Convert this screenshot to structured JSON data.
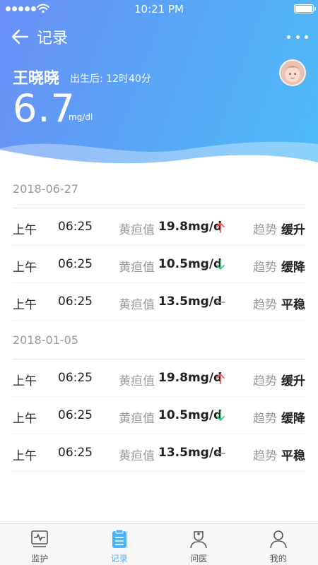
{
  "status_bar": {
    "time": "10:21 PM",
    "signal_bars": 5,
    "battery_level": 1.0
  },
  "nav": {
    "title": "记录",
    "back_icon": "back-arrow-icon",
    "more_icon": "more-dots-icon"
  },
  "baby": {
    "name": "王晓晓",
    "age_prefix": "出生后:",
    "age_value": "12时40分",
    "avatar_icon": "baby-avatar"
  },
  "current": {
    "value": "6.7",
    "unit": "mg/dl"
  },
  "groups": [
    {
      "date": "2018-06-27",
      "records": [
        {
          "period": "上午",
          "time": "06:25",
          "label": "黄疸值",
          "value": "19.8mg/d",
          "direction": "up",
          "trend_label": "趋势",
          "trend": "缓升"
        },
        {
          "period": "上午",
          "time": "06:25",
          "label": "黄疸值",
          "value": "10.5mg/d",
          "direction": "down",
          "trend_label": "趋势",
          "trend": "缓降"
        },
        {
          "period": "上午",
          "time": "06:25",
          "label": "黄疸值",
          "value": "13.5mg/d",
          "direction": "flat",
          "trend_label": "趋势",
          "trend": "平稳"
        }
      ]
    },
    {
      "date": "2018-01-05",
      "records": [
        {
          "period": "上午",
          "time": "06:25",
          "label": "黄疸值",
          "value": "19.8mg/d",
          "direction": "up",
          "trend_label": "趋势",
          "trend": "缓升"
        },
        {
          "period": "上午",
          "time": "06:25",
          "label": "黄疸值",
          "value": "10.5mg/d",
          "direction": "down",
          "trend_label": "趋势",
          "trend": "缓降"
        },
        {
          "period": "上午",
          "time": "06:25",
          "label": "黄疸值",
          "value": "13.5mg/d",
          "direction": "flat",
          "trend_label": "趋势",
          "trend": "平稳"
        }
      ]
    }
  ],
  "colors": {
    "up": "#f5574f",
    "down": "#3cc77a",
    "flat": "#999999",
    "accent": "#4db3f5"
  },
  "tabbar": {
    "items": [
      {
        "label": "监护",
        "icon": "monitor-icon",
        "active": false
      },
      {
        "label": "记录",
        "icon": "clipboard-icon",
        "active": true
      },
      {
        "label": "问医",
        "icon": "doctor-icon",
        "active": false
      },
      {
        "label": "我的",
        "icon": "user-icon",
        "active": false
      }
    ]
  }
}
